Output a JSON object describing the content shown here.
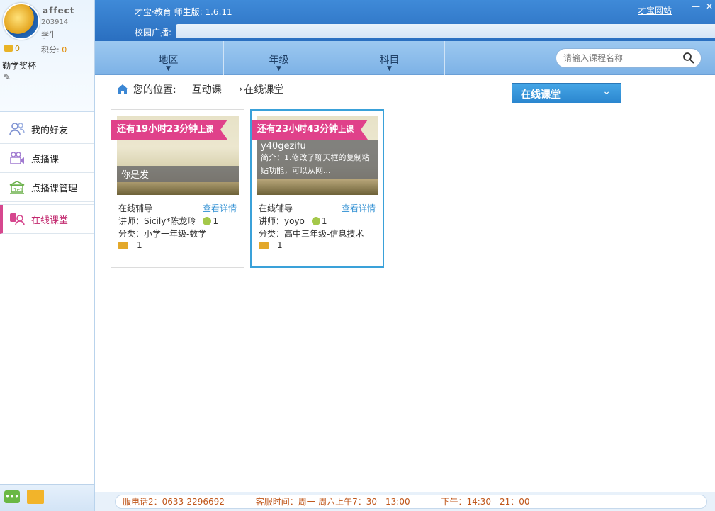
{
  "profile": {
    "username": "affect",
    "user_id": "203914",
    "role": "学生",
    "coins": "0",
    "points_label": "积分:",
    "points_value": "0",
    "award": "勤学奖杯"
  },
  "nav": {
    "items": [
      {
        "label": "我的好友",
        "icon": "friends-icon"
      },
      {
        "label": "点播课",
        "icon": "video-icon"
      },
      {
        "label": "点播课管理",
        "icon": "course-manage-icon"
      },
      {
        "label": "在线课堂",
        "icon": "online-class-icon"
      }
    ]
  },
  "header": {
    "app_title": "才宝·教育 师生版: 1.6.11",
    "site_link": "才宝网站",
    "minimize": "—",
    "close": "✕",
    "broadcast_label": "校园广播:"
  },
  "filters": [
    "地区",
    "年级",
    "科目"
  ],
  "search": {
    "placeholder": "请输入课程名称"
  },
  "breadcrumb": {
    "prefix": "您的位置:",
    "link": "互动课",
    "current": "在线课堂"
  },
  "classroom_select": {
    "value": "在线课堂"
  },
  "cards": [
    {
      "countdown": "还有19小时23分钟",
      "countdown_suffix": "上课",
      "title": "你是发",
      "summary": "",
      "type": "在线辅导",
      "detail": "查看详情",
      "teacher": "讲师：Sicily*陈龙玲",
      "medal_count": "1",
      "category": "分类：小学一年级-数学",
      "coins": "1"
    },
    {
      "countdown": "还有23小时43分钟",
      "countdown_suffix": "上课",
      "title": "y40gezifu",
      "summary": "简介：1.修改了聊天框的复制粘贴功能，可以从网...",
      "type": "在线辅导",
      "detail": "查看详情",
      "teacher": "讲师：yoyo",
      "medal_count": "1",
      "category": "分类：高中三年级-信息技术",
      "coins": "1"
    }
  ],
  "statusbar": {
    "phone": "服电话2：0633-2296692",
    "hours_am": "客服时间：周一-周六上午7：30—13:00",
    "hours_pm": "下午：14:30—21：00"
  },
  "colors": {
    "accent": "#2a6fc0",
    "ribbon": "#e0418a",
    "link": "#2f8fd3",
    "active_nav": "#c2286e"
  }
}
